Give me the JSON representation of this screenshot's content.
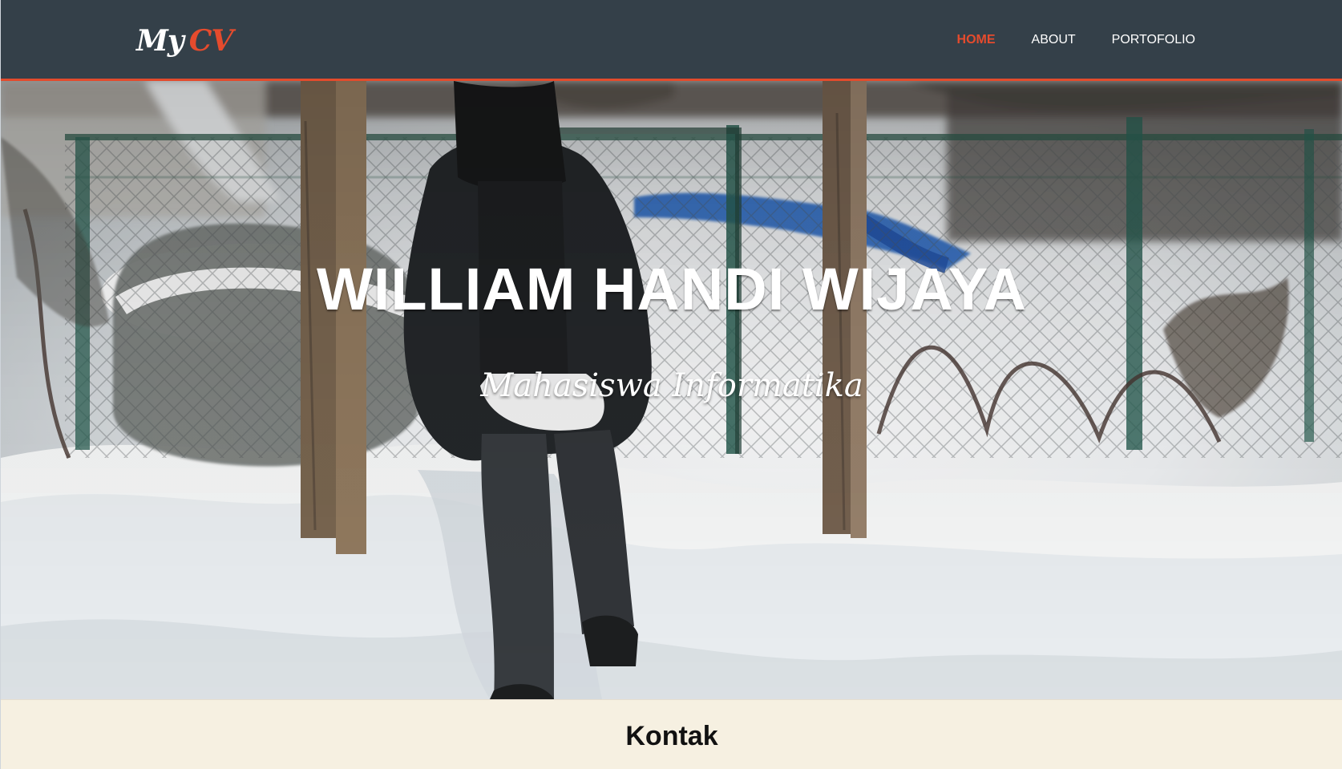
{
  "navbar": {
    "brand": {
      "first": "My",
      "second": "CV"
    },
    "items": [
      {
        "label": "HOME",
        "active": true
      },
      {
        "label": "ABOUT",
        "active": false
      },
      {
        "label": "PORTOFOLIO",
        "active": false
      }
    ]
  },
  "hero": {
    "name": "WILLIAM HANDI WIJAYA",
    "subtitle": "Mahasiswa Informatika"
  },
  "contact": {
    "title": "Kontak"
  },
  "colors": {
    "navbar_background": "#344049",
    "accent": "#e54b2d",
    "contact_background": "#f6f0e1"
  }
}
